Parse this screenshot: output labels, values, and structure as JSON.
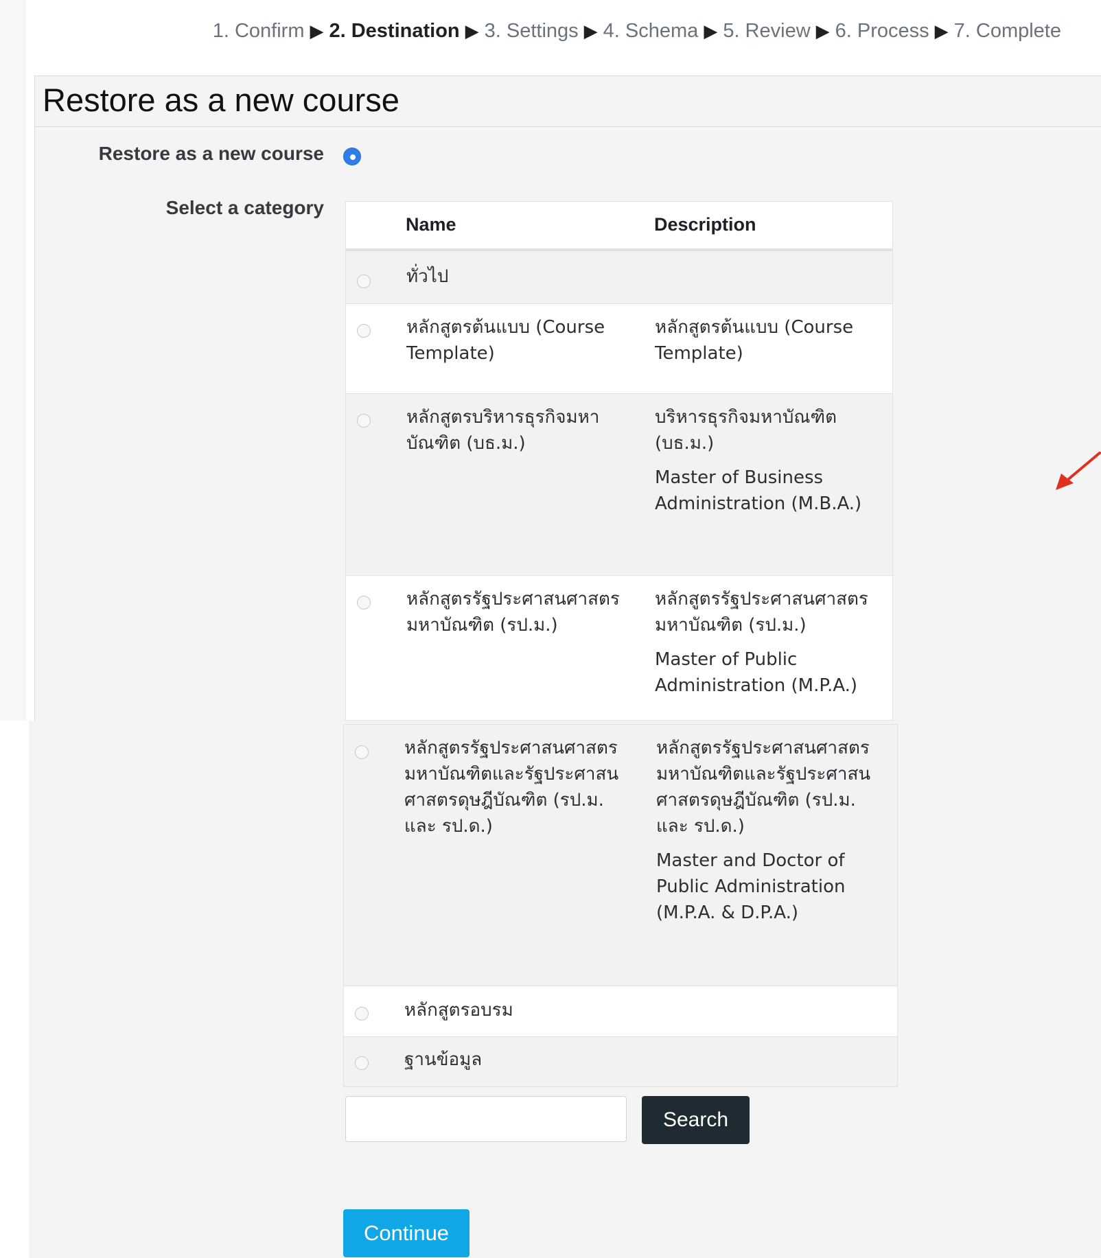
{
  "stepper": {
    "steps": [
      "1. Confirm",
      "2. Destination",
      "3. Settings",
      "4. Schema",
      "5. Review",
      "6. Process",
      "7. Complete"
    ],
    "current_step": "2. Destination",
    "separator": "▶"
  },
  "section": {
    "legend": "Restore as a new course",
    "restore_label": "Restore as a new course",
    "category_label": "Select a category"
  },
  "table": {
    "headers": {
      "name": "Name",
      "description": "Description"
    },
    "rows": [
      {
        "name": "ทั่วไป",
        "description_th": "",
        "description_en": ""
      },
      {
        "name": "หลักสูตรต้นแบบ (Course Template)",
        "description_th": "หลักสูตรต้นแบบ (Course Template)",
        "description_en": ""
      },
      {
        "name": "หลักสูตรบริหารธุรกิจมหาบัณฑิต (บธ.ม.)",
        "description_th": "บริหารธุรกิจมหาบัณฑิต (บธ.ม.)",
        "description_en": "Master of Business Administration (M.B.A.)"
      },
      {
        "name": "หลักสูตรรัฐประศาสนศาสตรมหาบัณฑิต (รป.ม.)",
        "description_th": "หลักสูตรรัฐประศาสนศาสตรมหาบัณฑิต (รป.ม.)",
        "description_en": "Master  of Public Administration (M.P.A.)"
      },
      {
        "name": "หลักสูตรรัฐประศาสนศาสตรมหาบัณฑิตและรัฐประศาสนศาสตรดุษฎีบัณฑิต (รป.ม. และ รป.ด.)",
        "description_th": "หลักสูตรรัฐประศาสนศาสตรมหาบัณฑิตและรัฐประศาสนศาสตรดุษฎีบัณฑิต (รป.ม. และ รป.ด.)",
        "description_en": "Master and Doctor of Public Administration (M.P.A. & D.P.A.)"
      },
      {
        "name": "หลักสูตรอบรม",
        "description_th": "",
        "description_en": ""
      },
      {
        "name": "ฐานข้อมูล",
        "description_th": "",
        "description_en": ""
      }
    ]
  },
  "search": {
    "value": "",
    "button_label": "Search"
  },
  "continue_label": "Continue",
  "colors": {
    "accent": "#2f7ee8",
    "continue": "#0fa7e6",
    "search_button": "#1f2b33",
    "arrow": "#e0301e"
  }
}
